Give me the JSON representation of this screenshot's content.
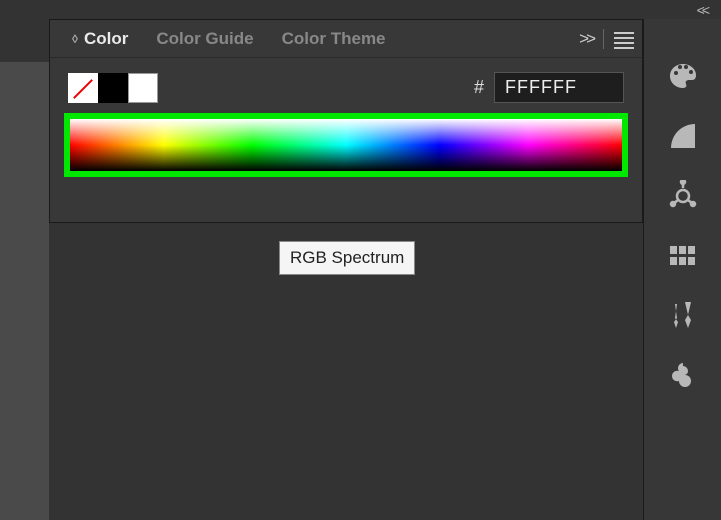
{
  "tabs": {
    "t0": "Color",
    "t1": "Color Guide",
    "t2": "Color Theme"
  },
  "hex": {
    "hash": "#",
    "value": "FFFFFF"
  },
  "tooltip": "RGB Spectrum"
}
